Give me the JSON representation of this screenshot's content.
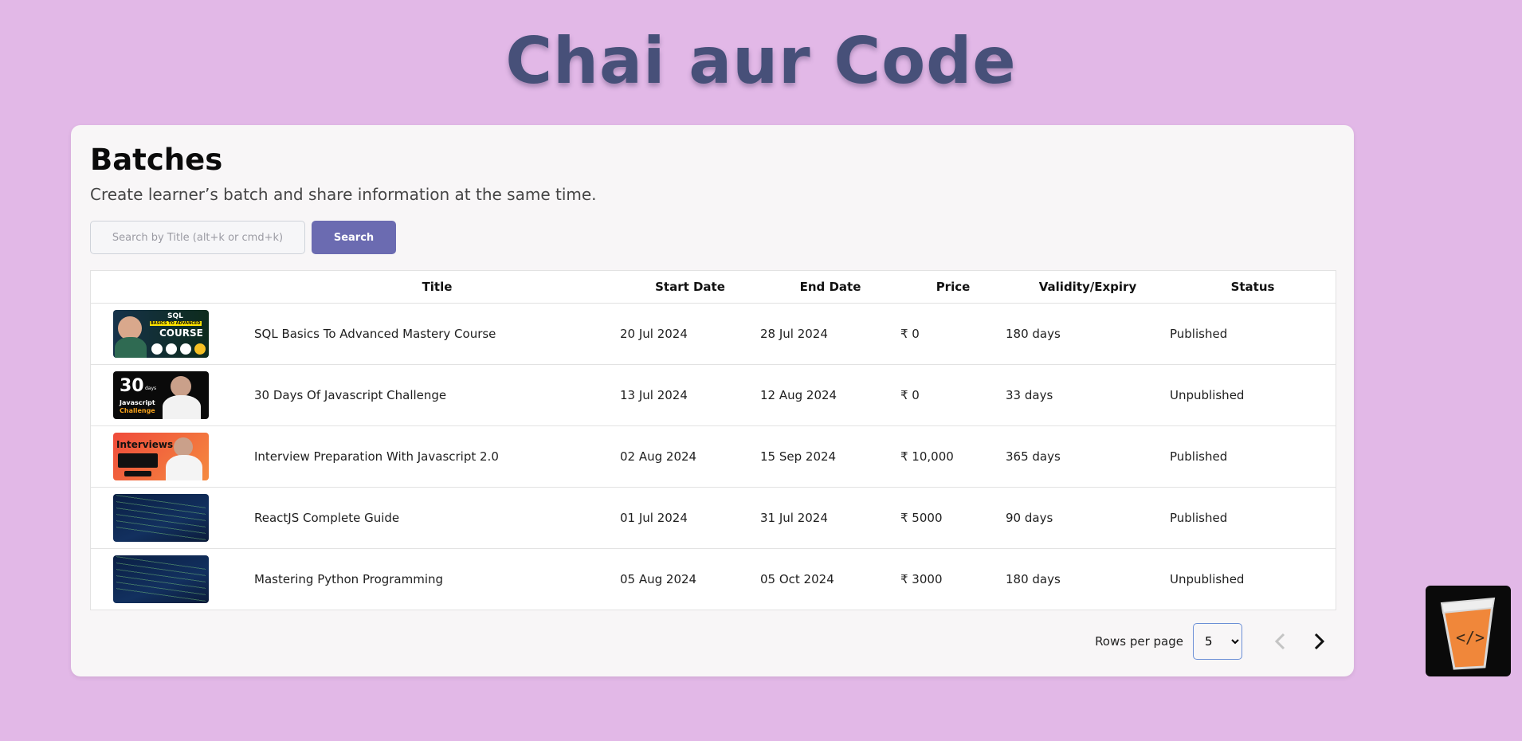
{
  "site": {
    "title": "Chai aur Code"
  },
  "batches": {
    "title": "Batches",
    "subtitle": "Create learner’s batch and share information at the same time.",
    "search": {
      "placeholder": "Search by Title (alt+k or cmd+k)",
      "value": "",
      "button_label": "Search"
    },
    "columns": [
      "",
      "Title",
      "Start Date",
      "End Date",
      "Price",
      "Validity/Expiry",
      "Status"
    ],
    "rows": [
      {
        "thumbnail": "sql-course-thumbnail",
        "thumb_text": [
          "SQL",
          "BASICS TO ADVANCED",
          "COURSE"
        ],
        "title": "SQL Basics To Advanced Mastery Course",
        "start_date": "20 Jul 2024",
        "end_date": "28 Jul 2024",
        "price": "₹ 0",
        "validity": "180 days",
        "status": "Published"
      },
      {
        "thumbnail": "javascript-challenge-thumbnail",
        "thumb_text": [
          "30",
          "days",
          "Javascript",
          "Challenge"
        ],
        "title": "30 Days Of Javascript Challenge",
        "start_date": "13 Jul 2024",
        "end_date": "12 Aug 2024",
        "price": "₹ 0",
        "validity": "33 days",
        "status": "Unpublished"
      },
      {
        "thumbnail": "interviews-thumbnail",
        "thumb_text": [
          "Interviews"
        ],
        "title": "Interview Preparation With Javascript 2.0",
        "start_date": "02 Aug 2024",
        "end_date": "15 Sep 2024",
        "price": "₹ 10,000",
        "validity": "365 days",
        "status": "Published"
      },
      {
        "thumbnail": "code-screen-thumbnail",
        "thumb_text": [],
        "title": "ReactJS Complete Guide",
        "start_date": "01 Jul 2024",
        "end_date": "31 Jul 2024",
        "price": "₹ 5000",
        "validity": "90 days",
        "status": "Published"
      },
      {
        "thumbnail": "code-screen-thumbnail",
        "thumb_text": [],
        "title": "Mastering Python Programming",
        "start_date": "05 Aug 2024",
        "end_date": "05 Oct 2024",
        "price": "₹ 3000",
        "validity": "180 days",
        "status": "Unpublished"
      }
    ],
    "pagination": {
      "rows_per_page_label": "Rows per page",
      "rows_per_page": "5",
      "options": [
        "5"
      ],
      "prev_icon": "chevron-left-icon",
      "next_icon": "chevron-right-icon"
    }
  },
  "brand_badge": {
    "icon": "chai-glass-icon",
    "glyph": "</>"
  },
  "colors": {
    "background": "#e2b8e7",
    "title": "#475079",
    "button": "#6b6bb1",
    "card": "#f8f6f7"
  }
}
